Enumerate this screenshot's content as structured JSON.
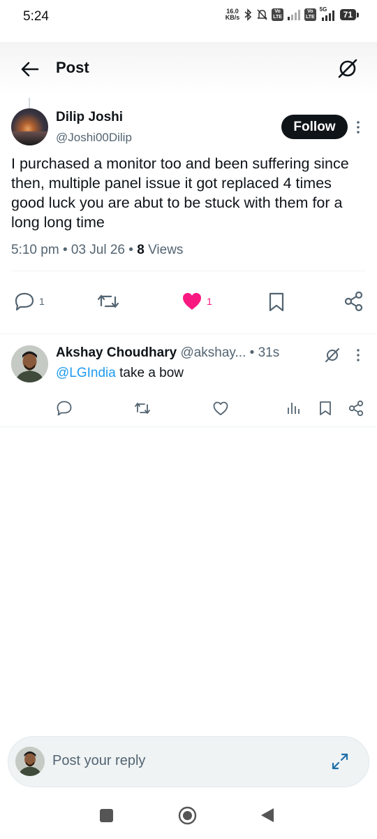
{
  "status_bar": {
    "time": "5:24",
    "net_speed_value": "16.0",
    "net_speed_unit": "KB/s",
    "volte1_top": "Vo",
    "volte1_bottom": "LTE",
    "volte2_top": "Vo",
    "volte2_bottom": "LTE",
    "network_type": "5G",
    "battery": "71"
  },
  "header": {
    "title": "Post",
    "back_icon": "arrow-left-icon",
    "grok_icon": "grok-icon"
  },
  "post": {
    "author_name": "Dilip Joshi",
    "author_handle": "@Joshi00Dilip",
    "follow_label": "Follow",
    "text": "I purchased a monitor too and been suffering since then, multiple panel issue it got replaced 4 times good luck you are abut to be stuck with them for a long long time",
    "time": "5:10 pm",
    "date": "03 Jul 26",
    "views_count": "8",
    "views_label": "Views",
    "separator": "•",
    "reply_count": "1",
    "like_count": "1",
    "like_color": "#f91880"
  },
  "reply": {
    "author_name": "Akshay Choudhary",
    "author_handle": "@akshay...",
    "time_ago": "31s",
    "separator": "•",
    "mention": "@LGIndia",
    "text": " take a bow",
    "mention_color": "#1d9bf0"
  },
  "composer": {
    "placeholder": "Post your reply",
    "expand_icon": "expand-icon"
  },
  "colors": {
    "text_primary": "#0f1419",
    "text_secondary": "#536471",
    "divider": "#eff3f4"
  }
}
